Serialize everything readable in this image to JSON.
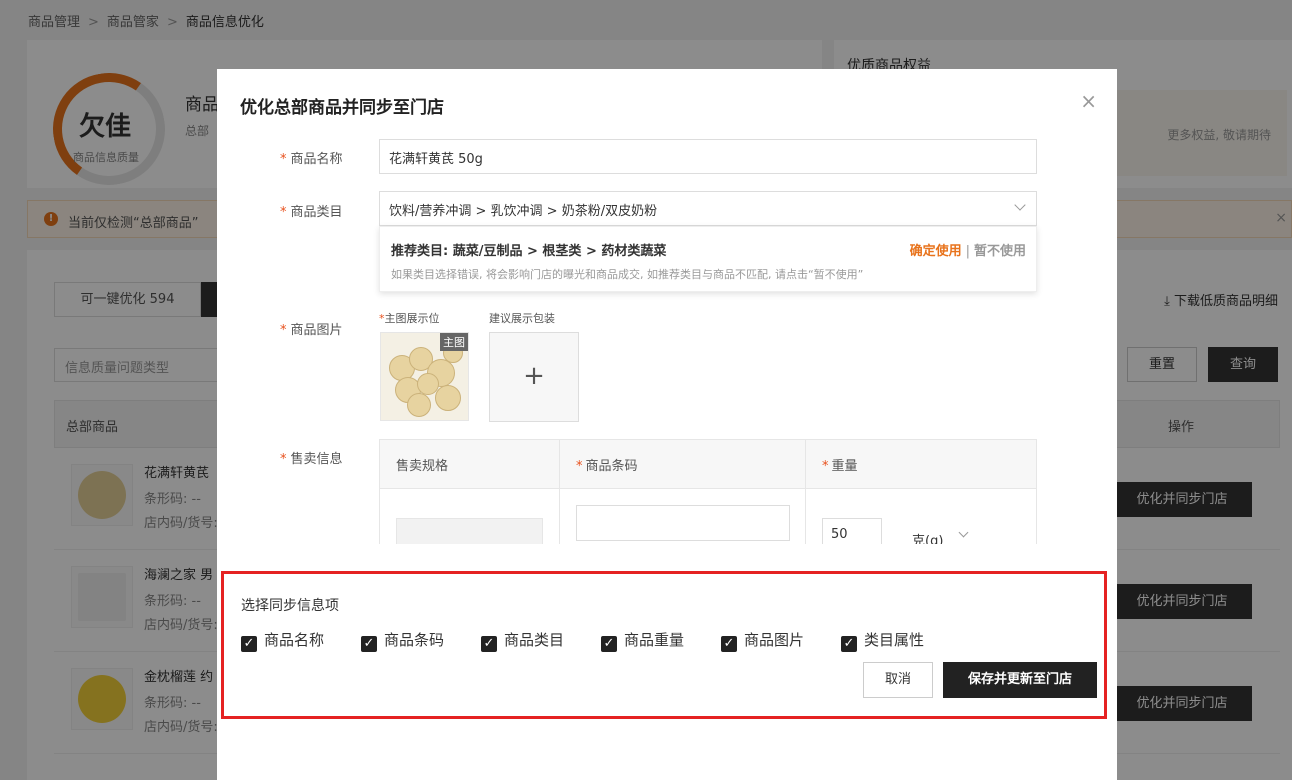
{
  "breadcrumb": [
    "商品管理",
    "商品管家",
    "商品信息优化"
  ],
  "score": {
    "grade": "欠佳",
    "caption": "商品信息质量",
    "title": "商品",
    "desc": "总部"
  },
  "rights": {
    "title": "优质商品权益",
    "note": "更多权益, 敬请期待"
  },
  "notice": {
    "text": "当前仅检测“总部商品”",
    "close": "×"
  },
  "tabs": {
    "optimizable": "可一键优化 594"
  },
  "download_label": "下载低质商品明细",
  "filter": {
    "placeholder": "信息质量问题类型"
  },
  "buttons": {
    "reset": "重置",
    "query": "查询"
  },
  "table": {
    "headers": {
      "goods": "总部商品",
      "op": "操作"
    },
    "rows": [
      {
        "name": "花满轩黄芪",
        "barcode": "条形码: --",
        "code": "店内码/货号:",
        "action": "优化并同步门店"
      },
      {
        "name": "海澜之家 男",
        "barcode": "条形码: --",
        "code": "店内码/货号:",
        "action": "优化并同步门店"
      },
      {
        "name": "金枕榴莲 约",
        "barcode": "条形码: --",
        "code": "店内码/货号: --",
        "action": "优化并同步门店"
      }
    ]
  },
  "modal": {
    "title": "优化总部商品并同步至门店",
    "close_icon": "×",
    "fields": {
      "name": {
        "label": "商品名称",
        "value": "花满轩黄芪 50g"
      },
      "category": {
        "label": "商品类目",
        "value": "饮料/营养冲调 > 乳饮冲调 > 奶茶粉/双皮奶粉"
      },
      "image": {
        "label": "商品图片",
        "main_label": "主图展示位",
        "package_label": "建议展示包装",
        "main_tag": "主图",
        "add": "+"
      },
      "sale": {
        "label": "售卖信息"
      }
    },
    "recommend": {
      "text": "推荐类目: 蔬菜/豆制品 > 根茎类 > 药材类蔬菜",
      "confirm": "确定使用",
      "sep": "|",
      "cancel": "暂不使用",
      "hint": "如果类目选择错误, 将会影响门店的曝光和商品成交, 如推荐类目与商品不匹配, 请点击“暂不使用”"
    },
    "sale_table": {
      "headers": [
        "售卖规格",
        "商品条码",
        "重量"
      ],
      "weight_value": "50",
      "unit": "克(g)"
    },
    "sync": {
      "title": "选择同步信息项",
      "options": [
        {
          "label": "商品名称",
          "checked": true
        },
        {
          "label": "商品条码",
          "checked": true
        },
        {
          "label": "商品类目",
          "checked": true
        },
        {
          "label": "商品重量",
          "checked": true
        },
        {
          "label": "商品图片",
          "checked": true
        },
        {
          "label": "类目属性",
          "checked": true
        }
      ],
      "cancel": "取消",
      "save": "保存并更新至门店"
    }
  },
  "colors": {
    "accent": "#e8731c",
    "dark": "#222222",
    "highlight": "#e52222"
  }
}
